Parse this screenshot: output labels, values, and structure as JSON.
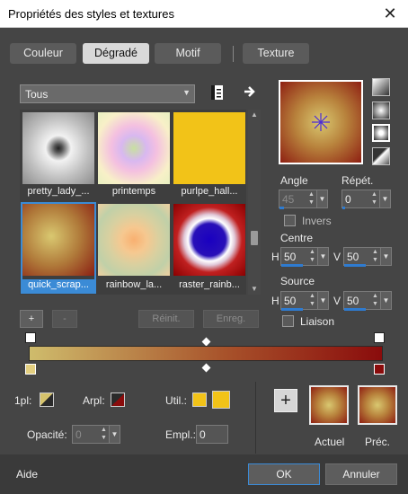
{
  "window": {
    "title": "Propriétés des styles et textures",
    "close_glyph": "✕"
  },
  "tabs": [
    {
      "label": "Couleur",
      "active": false
    },
    {
      "label": "Dégradé",
      "active": true
    },
    {
      "label": "Motif",
      "active": false
    },
    {
      "label": "Texture",
      "active": false
    }
  ],
  "category": {
    "value": "Tous",
    "arrow": "▼"
  },
  "icons": {
    "library": "library-icon",
    "arrow_right": "arrow-right-icon"
  },
  "thumbnails": [
    {
      "label": "pretty_lady_...",
      "selected": false
    },
    {
      "label": "printemps",
      "selected": false
    },
    {
      "label": "purlpe_hall...",
      "selected": false
    },
    {
      "label": "quick_scrap...",
      "selected": true
    },
    {
      "label": "rainbow_la...",
      "selected": false
    },
    {
      "label": "raster_rainb...",
      "selected": false
    }
  ],
  "list_buttons": {
    "add": "+",
    "remove": "-",
    "reset": "Réinit.",
    "save": "Enreg."
  },
  "angle": {
    "label": "Angle",
    "value": "45",
    "level": 0.125
  },
  "repeat": {
    "label": "Répét.",
    "value": "0",
    "level": 0.0
  },
  "invert": {
    "label": "Invers",
    "checked": false
  },
  "center": {
    "label": "Centre",
    "h_label": "H",
    "h_value": "50",
    "v_label": "V",
    "v_value": "50"
  },
  "source": {
    "label": "Source",
    "h_label": "H",
    "h_value": "50",
    "v_label": "V",
    "v_value": "50"
  },
  "link": {
    "label": "Liaison",
    "checked": false
  },
  "gradient": {
    "start_color": "#cfbc6c",
    "mid_color": "#a8532b",
    "end_color": "#8a0c0c"
  },
  "controls": {
    "fg_label": "1pl:",
    "bg_label": "Arpl:",
    "user_label": "Util.:",
    "opacity_label": "Opacité:",
    "opacity_value": "0",
    "location_label": "Empl.:",
    "location_value": "0",
    "user_color": "#f2c318"
  },
  "current": {
    "label": "Actuel"
  },
  "previous": {
    "label": "Préc."
  },
  "footer": {
    "help": "Aide",
    "ok": "OK",
    "cancel": "Annuler"
  }
}
